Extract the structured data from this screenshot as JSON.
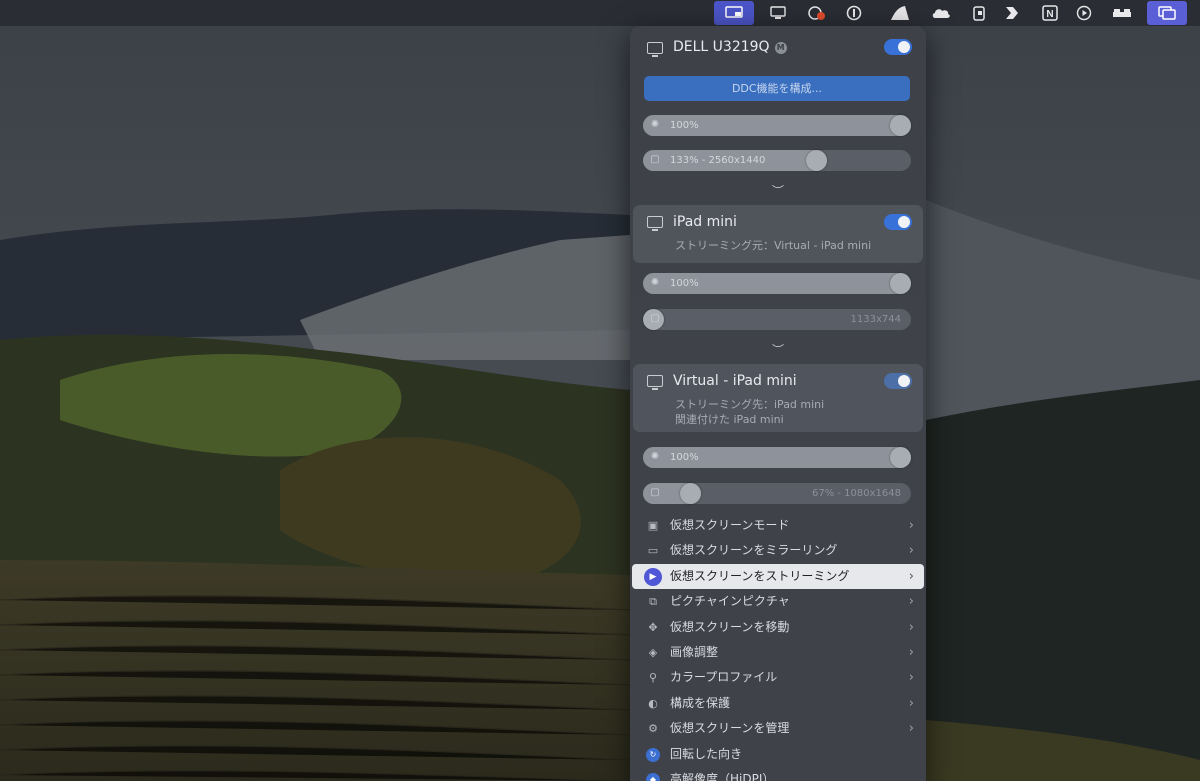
{
  "menubar": {
    "icons": [
      "display-icon",
      "monitor-icon",
      "cursor-record-icon",
      "onepassword-icon",
      "ghost-icon",
      "cloud-icon",
      "battery-icon",
      "chevron-app-icon",
      "notion-icon",
      "play-icon",
      "bed-icon",
      "screens-icon"
    ]
  },
  "displays": {
    "dell": {
      "name": "DELL U3219Q",
      "badge": "M",
      "ddc_button": "DDC機能を構成...",
      "brightness": "100%",
      "resolution": "133% - 2560x1440",
      "resolution_level": 0.65
    },
    "ipad": {
      "name": "iPad mini",
      "sub": "ストリーミング元：Virtual - iPad mini",
      "brightness": "100%",
      "resolution": "1133x744"
    },
    "virtual": {
      "name": "Virtual - iPad mini",
      "sub1": "ストリーミング先：iPad mini",
      "sub2": "関連付けた iPad mini",
      "brightness": "100%",
      "resolution": "67% - 1080x1648",
      "resolution_level": 0.22
    }
  },
  "menu_items": [
    {
      "label": "仮想スクリーンモード",
      "icon": "lock-icon",
      "arrow": true
    },
    {
      "label": "仮想スクリーンをミラーリング",
      "icon": "mirror-icon",
      "arrow": true
    },
    {
      "label": "仮想スクリーンをストリーミング",
      "icon": "stream-icon",
      "arrow": true
    },
    {
      "label": "ピクチャインピクチャ",
      "icon": "pip-icon",
      "arrow": true
    },
    {
      "label": "仮想スクリーンを移動",
      "icon": "move-icon",
      "arrow": true
    },
    {
      "label": "画像調整",
      "icon": "image-adjust-icon",
      "arrow": true
    },
    {
      "label": "カラープロファイル",
      "icon": "color-profile-icon",
      "arrow": true
    },
    {
      "label": "構成を保護",
      "icon": "protect-icon",
      "arrow": true
    },
    {
      "label": "仮想スクリーンを管理",
      "icon": "manage-icon",
      "arrow": true
    },
    {
      "label": "回転した向き",
      "icon": "rotate-icon",
      "arrow": false
    },
    {
      "label": "高解像度（HiDPI）",
      "icon": "hidpi-icon",
      "arrow": false
    }
  ],
  "colors": {
    "accent": "#3871d8",
    "highlight": "#e7e8ec"
  }
}
